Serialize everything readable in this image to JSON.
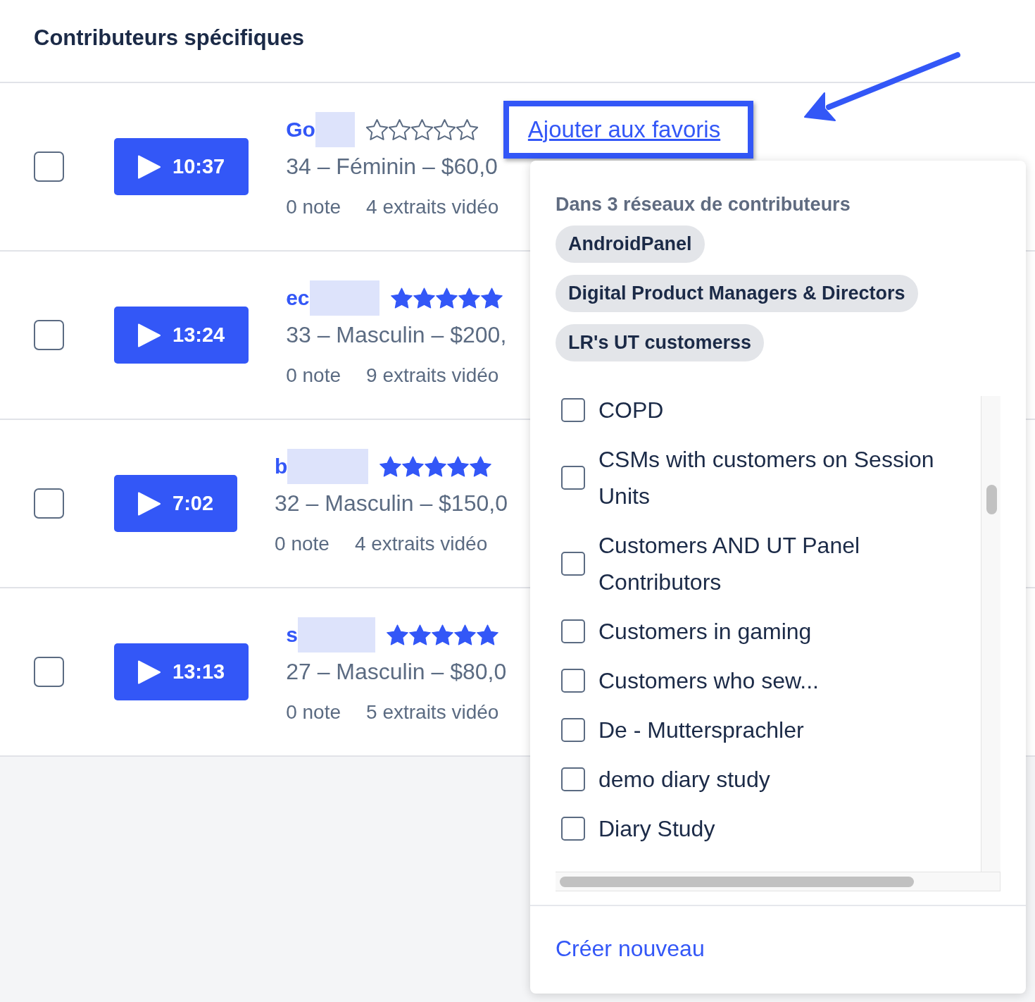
{
  "page": {
    "title": "Contributeurs spécifiques"
  },
  "contributors": [
    {
      "checked": false,
      "duration": "10:37",
      "name": "Go",
      "stars": 0,
      "details": "34 – Féminin – $60,0",
      "notes": "0 note",
      "clips": "4 extraits vidéo",
      "favorite_link": "Ajouter aux favoris"
    },
    {
      "checked": false,
      "duration": "13:24",
      "name": "ec",
      "stars": 5,
      "details": "33 – Masculin – $200,",
      "notes": "0 note",
      "clips": "9 extraits vidéo"
    },
    {
      "checked": false,
      "duration": "7:02",
      "name": "b",
      "stars": 5,
      "details": "32 – Masculin – $150,0",
      "notes": "0 note",
      "clips": "4 extraits vidéo"
    },
    {
      "checked": false,
      "duration": "13:13",
      "name": "s",
      "stars": 5,
      "details": "27 – Masculin – $80,0",
      "notes": "0 note",
      "clips": "5 extraits vidéo"
    }
  ],
  "networks_dropdown": {
    "heading": "Dans 3 réseaux de contributeurs",
    "networks": [
      "AndroidPanel",
      "Digital Product Managers & Directors",
      "LR's UT customerss"
    ],
    "lists": [
      {
        "label": "COPD",
        "checked": false
      },
      {
        "label": "CSMs with customers on Session Units",
        "checked": false
      },
      {
        "label": "Customers AND UT Panel Contributors",
        "checked": false
      },
      {
        "label": "Customers in gaming",
        "checked": false
      },
      {
        "label": "Customers who sew...",
        "checked": false
      },
      {
        "label": "De - Muttersprachler",
        "checked": false
      },
      {
        "label": "demo diary study",
        "checked": false
      },
      {
        "label": "Diary Study",
        "checked": false
      }
    ],
    "create_link": "Créer nouveau"
  }
}
